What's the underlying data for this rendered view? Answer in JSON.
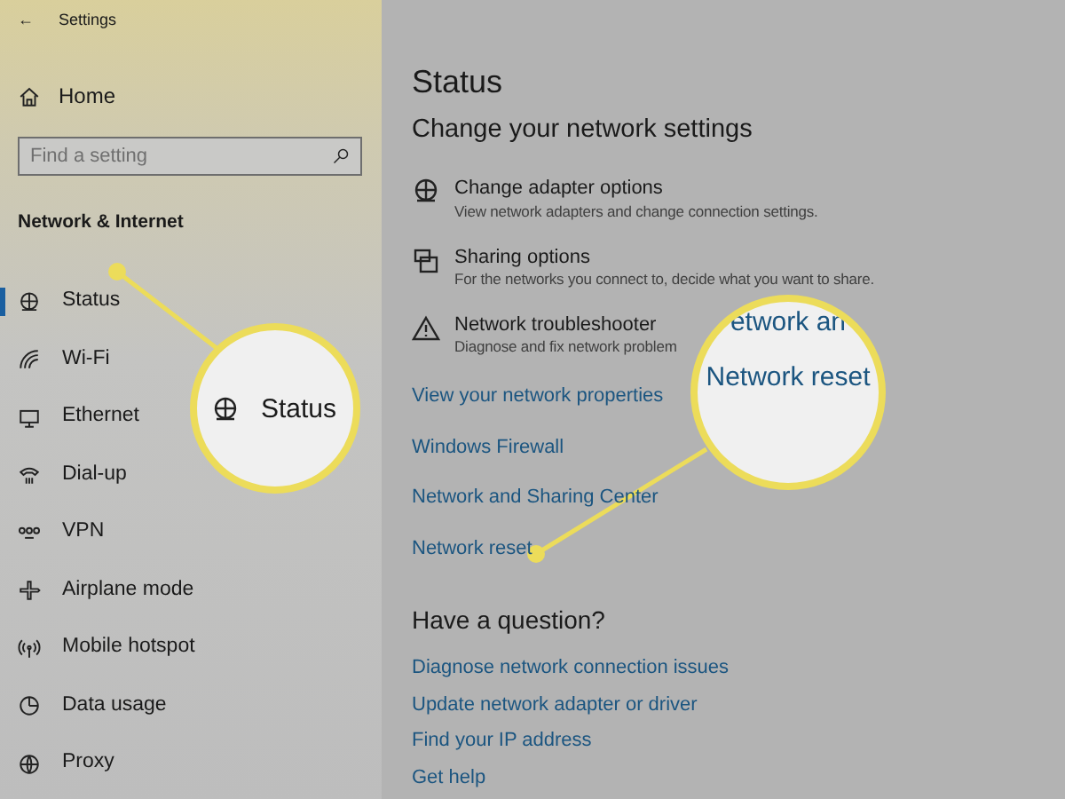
{
  "window": {
    "title": "Settings",
    "back": "←"
  },
  "sidebar": {
    "home": "Home",
    "search": {
      "placeholder": "Find a setting"
    },
    "heading": "Network & Internet",
    "items": [
      {
        "label": "Status",
        "selected": true
      },
      {
        "label": "Wi-Fi",
        "selected": false
      },
      {
        "label": "Ethernet",
        "selected": false
      },
      {
        "label": "Dial-up",
        "selected": false
      },
      {
        "label": "VPN",
        "selected": false
      },
      {
        "label": "Airplane mode",
        "selected": false
      },
      {
        "label": "Mobile hotspot",
        "selected": false
      },
      {
        "label": "Data usage",
        "selected": false
      },
      {
        "label": "Proxy",
        "selected": false
      }
    ]
  },
  "main": {
    "title": "Status",
    "subtitle": "Change your network settings",
    "options": [
      {
        "title": "Change adapter options",
        "description": "View network adapters and change connection settings."
      },
      {
        "title": "Sharing options",
        "description": "For the networks you connect to, decide what you want to share."
      },
      {
        "title": "Network troubleshooter",
        "description": "Diagnose and fix network problem"
      }
    ],
    "links": [
      "View your network properties",
      "Windows Firewall",
      "Network and Sharing Center",
      "Network reset"
    ],
    "question": {
      "heading": "Have a question?",
      "links": [
        "Diagnose network connection issues",
        "Update network adapter or driver",
        "Find your IP address",
        "Get help"
      ]
    }
  },
  "callouts": [
    {
      "lines": [
        "Status"
      ]
    },
    {
      "lines": [
        "etwork an",
        "Network reset"
      ]
    }
  ]
}
